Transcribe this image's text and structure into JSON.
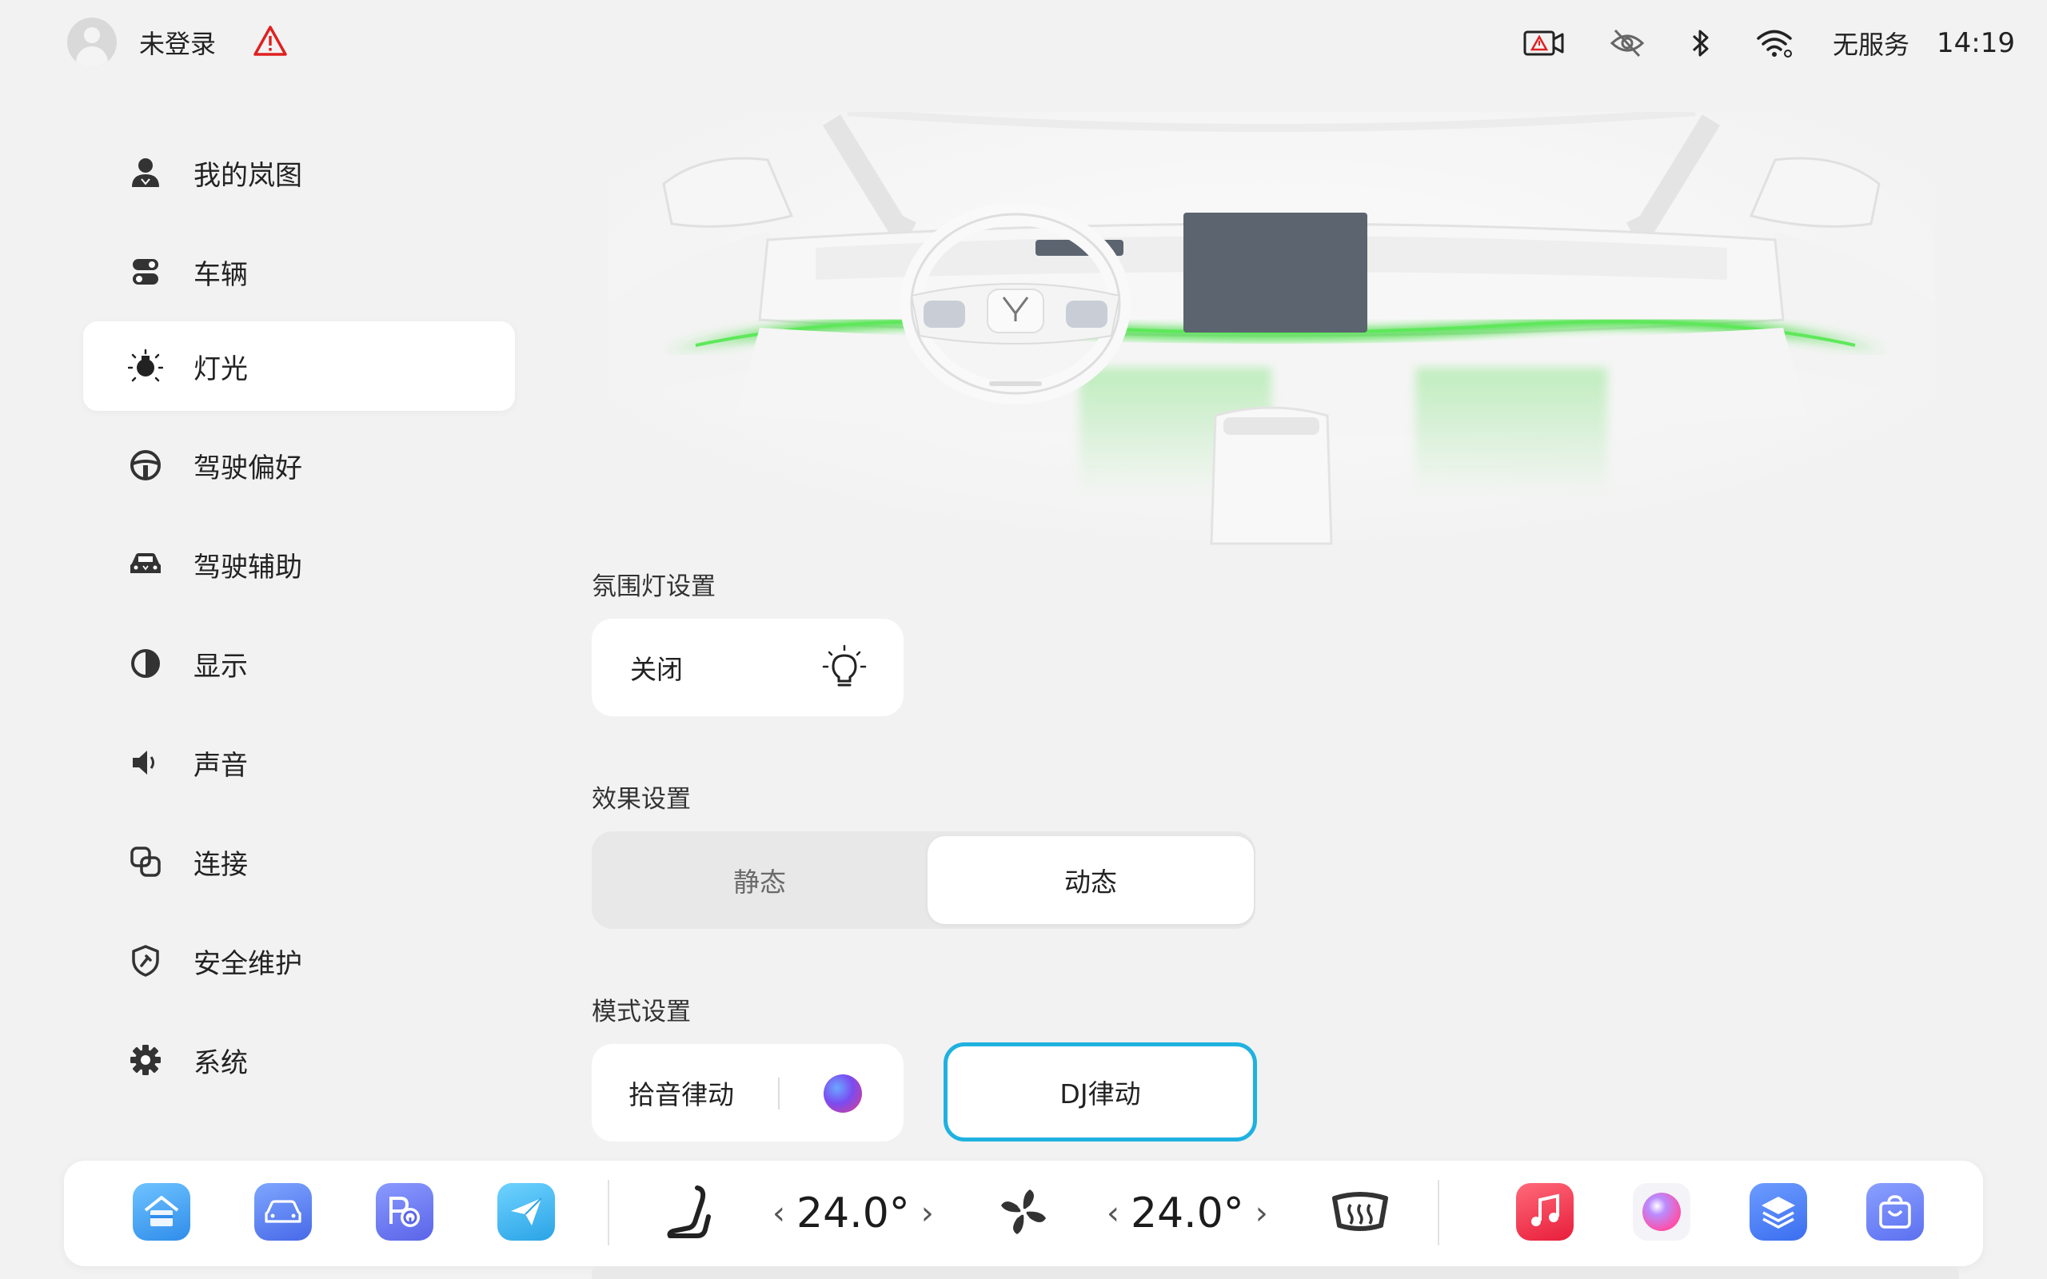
{
  "status": {
    "user_label": "未登录",
    "service": "无服务",
    "time": "14:19",
    "icons": [
      "dashcam-alert-icon",
      "camera-off-icon",
      "bluetooth-icon",
      "wifi-icon"
    ]
  },
  "sidebar": {
    "items": [
      {
        "label": "我的岚图",
        "icon": "user-icon"
      },
      {
        "label": "车辆",
        "icon": "vehicle-toggle-icon"
      },
      {
        "label": "灯光",
        "icon": "light-icon",
        "active": true
      },
      {
        "label": "驾驶偏好",
        "icon": "steering-wheel-icon"
      },
      {
        "label": "驾驶辅助",
        "icon": "car-assist-icon"
      },
      {
        "label": "显示",
        "icon": "contrast-icon"
      },
      {
        "label": "声音",
        "icon": "speaker-icon"
      },
      {
        "label": "连接",
        "icon": "connect-icon"
      },
      {
        "label": "安全维护",
        "icon": "shield-icon"
      },
      {
        "label": "系统",
        "icon": "gear-icon"
      }
    ]
  },
  "ambient": {
    "section_title": "氛围灯设置",
    "value_label": "关闭"
  },
  "effect": {
    "section_title": "效果设置",
    "options": [
      "静态",
      "动态"
    ],
    "selected": "动态"
  },
  "mode": {
    "section_title": "模式设置",
    "option1": "拾音律动",
    "option2": "DJ律动",
    "selected": "DJ律动"
  },
  "dock": {
    "left_temp": "24.0°",
    "right_temp": "24.0°",
    "apps_left": [
      "home-app-icon",
      "car-app-icon",
      "parking-app-icon",
      "navigation-app-icon"
    ],
    "apps_right": [
      "music-app-icon",
      "assistant-app-icon",
      "layers-app-icon",
      "store-app-icon"
    ],
    "colors": {
      "accent_border": "#1fb2e0",
      "ambient_glow": "#3ddc3a"
    }
  }
}
